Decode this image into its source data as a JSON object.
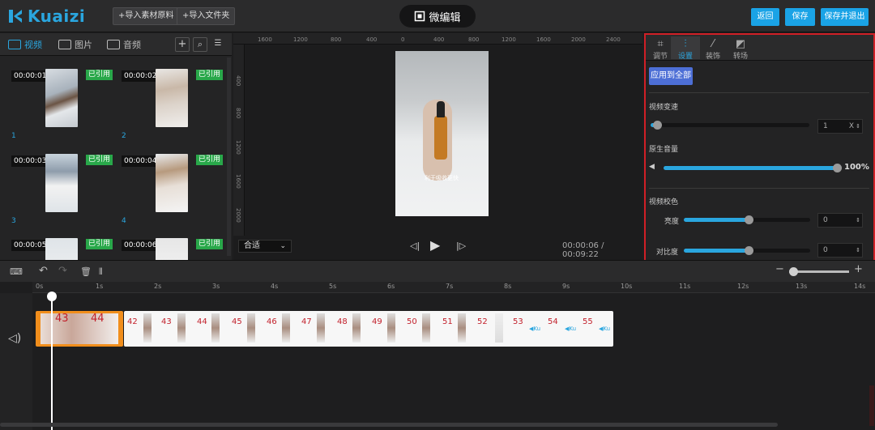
{
  "app": {
    "logo_text": "Kuaizi",
    "title": "微编辑",
    "brand_color": "#1aa3e6",
    "accent_red": "#d01f26"
  },
  "topbar": {
    "import_material": "+导入素材原料",
    "import_folder": "+导入文件夹",
    "back": "返回",
    "save": "保存",
    "save_exit": "保存并退出"
  },
  "media": {
    "tabs": [
      {
        "label": "视频",
        "icon": "video-icon",
        "active": true
      },
      {
        "label": "图片",
        "icon": "image-icon",
        "active": false
      },
      {
        "label": "音频",
        "icon": "audio-icon",
        "active": false
      }
    ],
    "items": [
      {
        "time": "00:00:01",
        "badge": "已引用",
        "index": "1"
      },
      {
        "time": "00:00:02",
        "badge": "已引用",
        "index": "2"
      },
      {
        "time": "00:00:03",
        "badge": "已引用",
        "index": "3"
      },
      {
        "time": "00:00:04",
        "badge": "已引用",
        "index": "4"
      },
      {
        "time": "00:00:05",
        "badge": "已引用",
        "index": ""
      },
      {
        "time": "00:00:06",
        "badge": "已引用",
        "index": ""
      }
    ]
  },
  "preview": {
    "ruler_h": [
      "1600",
      "1200",
      "800",
      "400",
      "0",
      "400",
      "800",
      "1200",
      "1600",
      "2000",
      "2400"
    ],
    "ruler_v": [
      "400",
      "800",
      "1200",
      "1600",
      "2000"
    ],
    "subtitle": "利于吸收更快",
    "fit": "合适",
    "time": "00:00:06 / 00:09:22"
  },
  "props": {
    "tabs": [
      {
        "label": "调节",
        "icon": "crop-icon",
        "active": false
      },
      {
        "label": "设置",
        "icon": "sliders-icon",
        "active": true
      },
      {
        "label": "装饰",
        "icon": "magic-wand-icon",
        "active": false
      },
      {
        "label": "转场",
        "icon": "transition-icon",
        "active": false
      }
    ],
    "apply_all": "应用到全部",
    "speed_label": "视频变速",
    "speed_value": "1",
    "speed_unit": "X",
    "volume_label": "原生音量",
    "volume_value": "100%",
    "grading_label": "视频校色",
    "brightness_label": "亮度",
    "brightness_value": "0",
    "contrast_label": "对比度",
    "contrast_value": "0"
  },
  "timeline": {
    "ticks": [
      "0s",
      "1s",
      "2s",
      "3s",
      "4s",
      "5s",
      "6s",
      "7s",
      "8s",
      "9s",
      "10s",
      "11s",
      "12s",
      "13s",
      "14s"
    ],
    "clip_a_frames": [
      "43",
      "44"
    ],
    "clip_b_frames": [
      "42",
      "43",
      "44",
      "45",
      "46",
      "47",
      "48",
      "49",
      "50",
      "51",
      "52",
      "53",
      "54",
      "55"
    ]
  }
}
